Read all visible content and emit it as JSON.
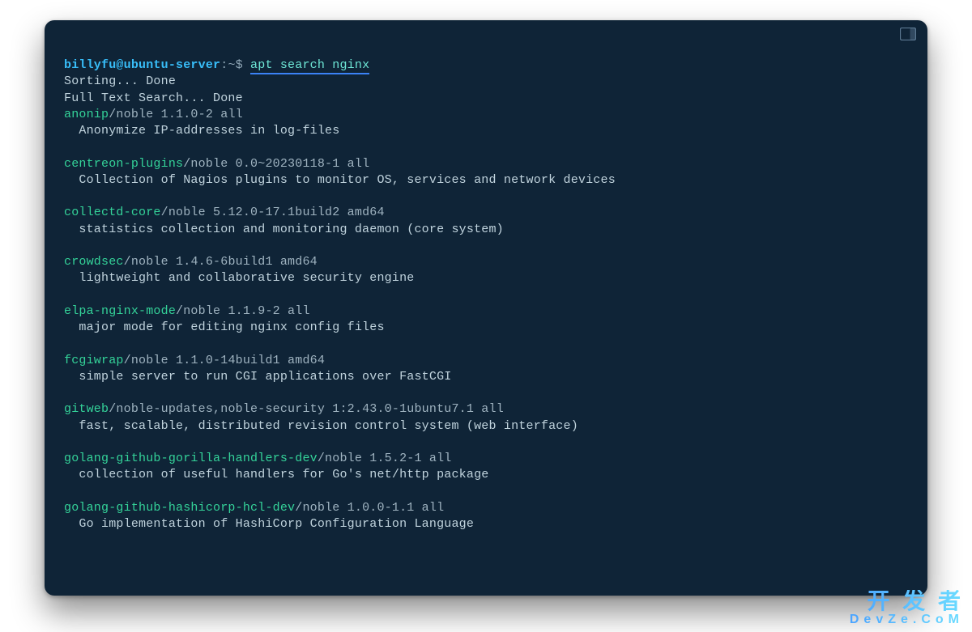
{
  "prompt": {
    "user_host": "billyfu@ubuntu-server",
    "sep": ":",
    "cwd": "~",
    "dollar": "$",
    "command": "apt search nginx"
  },
  "output_lines": [
    "Sorting... Done",
    "Full Text Search... Done"
  ],
  "packages": [
    {
      "name": "anonip",
      "rest": "/noble 1.1.0-2 all",
      "desc": "Anonymize IP-addresses in log-files"
    },
    {
      "name": "centreon-plugins",
      "rest": "/noble 0.0~20230118-1 all",
      "desc": "Collection of Nagios plugins to monitor OS, services and network devices"
    },
    {
      "name": "collectd-core",
      "rest": "/noble 5.12.0-17.1build2 amd64",
      "desc": "statistics collection and monitoring daemon (core system)"
    },
    {
      "name": "crowdsec",
      "rest": "/noble 1.4.6-6build1 amd64",
      "desc": "lightweight and collaborative security engine"
    },
    {
      "name": "elpa-nginx-mode",
      "rest": "/noble 1.1.9-2 all",
      "desc": "major mode for editing nginx config files"
    },
    {
      "name": "fcgiwrap",
      "rest": "/noble 1.1.0-14build1 amd64",
      "desc": "simple server to run CGI applications over FastCGI"
    },
    {
      "name": "gitweb",
      "rest": "/noble-updates,noble-security 1:2.43.0-1ubuntu7.1 all",
      "desc": "fast, scalable, distributed revision control system (web interface)"
    },
    {
      "name": "golang-github-gorilla-handlers-dev",
      "rest": "/noble 1.5.2-1 all",
      "desc": "collection of useful handlers for Go's net/http package"
    },
    {
      "name": "golang-github-hashicorp-hcl-dev",
      "rest": "/noble 1.0.0-1.1 all",
      "desc": "Go implementation of HashiCorp Configuration Language"
    }
  ],
  "watermark": {
    "top": "开 发 者",
    "bottom": "DevZe.CoM"
  }
}
